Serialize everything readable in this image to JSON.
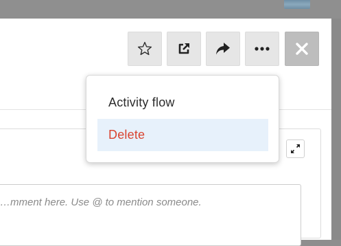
{
  "background": {
    "thumbnail_icon": "image-thumbnail-icon"
  },
  "toolbar": {
    "buttons": [
      {
        "icon": "star-icon"
      },
      {
        "icon": "open-external-icon"
      },
      {
        "icon": "share-arrow-icon"
      },
      {
        "icon": "more-options-icon"
      },
      {
        "icon": "close-icon"
      }
    ]
  },
  "menu": {
    "items": [
      {
        "label": "Activity flow"
      },
      {
        "label": "Delete",
        "color": "#d9432f",
        "highlight": "#e7f1fb"
      }
    ]
  },
  "content": {
    "expand_icon": "expand-icon"
  },
  "comment": {
    "placeholder": "…mment here. Use @ to mention someone."
  }
}
